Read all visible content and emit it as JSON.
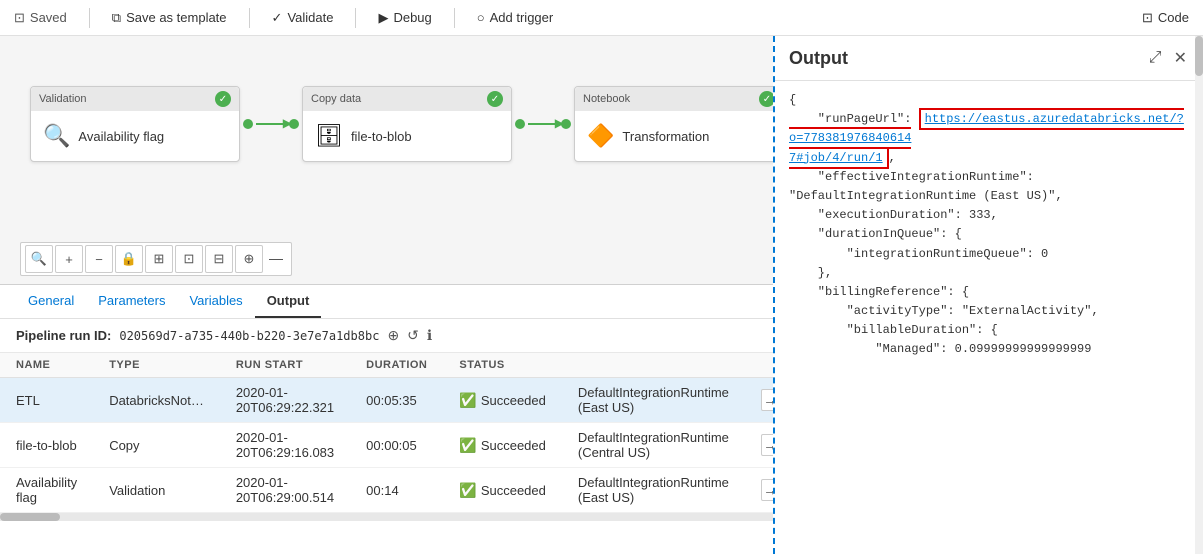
{
  "toolbar": {
    "saved_label": "Saved",
    "save_template_label": "Save as template",
    "validate_label": "Validate",
    "debug_label": "Debug",
    "add_trigger_label": "Add trigger",
    "code_label": "Code"
  },
  "pipeline": {
    "nodes": [
      {
        "id": "node1",
        "type": "Validation",
        "label": "Availability flag",
        "icon": "🔍",
        "status": "✓"
      },
      {
        "id": "node2",
        "type": "Copy data",
        "label": "file-to-blob",
        "icon": "🗄",
        "status": "✓"
      },
      {
        "id": "node3",
        "type": "Notebook",
        "label": "Transformation",
        "icon": "🔶",
        "status": "✓"
      }
    ]
  },
  "tabs": {
    "items": [
      {
        "id": "general",
        "label": "General"
      },
      {
        "id": "parameters",
        "label": "Parameters"
      },
      {
        "id": "variables",
        "label": "Variables"
      },
      {
        "id": "output",
        "label": "Output"
      }
    ],
    "active": "output"
  },
  "run_info": {
    "label": "Pipeline run ID:",
    "id": "020569d7-a735-440b-b220-3e7e7a1db8bc"
  },
  "table": {
    "columns": [
      "NAME",
      "TYPE",
      "RUN START",
      "DURATION",
      "STATUS",
      ""
    ],
    "rows": [
      {
        "name": "ETL",
        "type": "DatabricksNot",
        "run_start": "2020-01-20T06:29:22.321",
        "duration": "00:05:35",
        "status": "Succeeded",
        "integration": "DefaultIntegrationRuntime (East US)",
        "selected": true,
        "show_export": true
      },
      {
        "name": "file-to-blob",
        "type": "Copy",
        "run_start": "2020-01-20T06:29:16.083",
        "duration": "00:00:05",
        "status": "Succeeded",
        "integration": "DefaultIntegrationRuntime (Central US)",
        "selected": false,
        "show_export": false
      },
      {
        "name": "Availability flag",
        "type": "Validation",
        "run_start": "2020-01-20T06:29:00.514",
        "duration": "00:14",
        "status": "Succeeded",
        "integration": "DefaultIntegrationRuntime (East US)",
        "selected": false,
        "show_export": false
      }
    ]
  },
  "output": {
    "title": "Output",
    "content_lines": [
      "{",
      "    \"runPageUrl\": \"",
      "https://eastus.azuredatabricks.net/?o=778381976840614",
      "7#job/4/run/1",
      "\",",
      "    \"effectiveIntegrationRuntime\": \"DefaultIntegrationRuntime (East",
      "US)\",",
      "    \"executionDuration\": 333,",
      "    \"durationInQueue\": {",
      "        \"integrationRuntimeQueue\": 0",
      "    },",
      "    \"billingReference\": {",
      "        \"activityType\": \"ExternalActivity\",",
      "        \"billableDuration\": {",
      "            \"Managed\": 0.09999999999999999"
    ],
    "url": "https://eastus.azuredatabricks.net/?o=7783819768406147#job/4/run/1"
  },
  "zoom_controls": {
    "search": "🔍",
    "add": "+",
    "minus": "−",
    "lock": "🔒",
    "fit": "⊞",
    "select": "⊡",
    "arrange": "⊟",
    "branch": "⊕"
  }
}
